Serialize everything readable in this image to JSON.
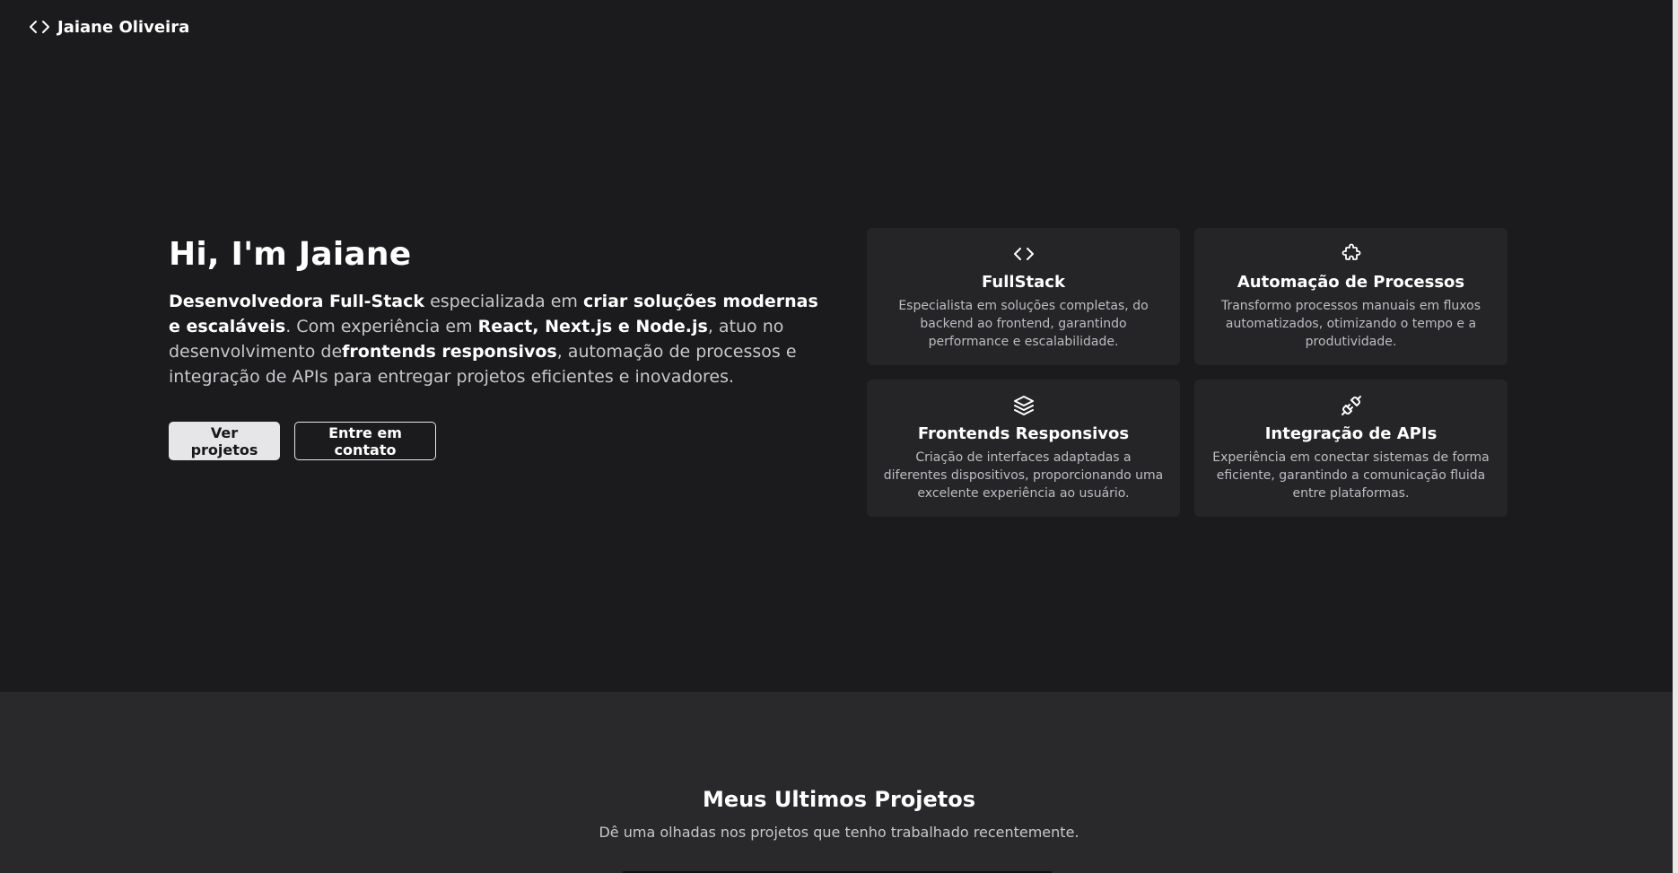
{
  "header": {
    "brand_icon": "code-brackets-icon",
    "brand_name": "Jaiane Oliveira"
  },
  "hero": {
    "title": "Hi, I'm Jaiane",
    "description": {
      "p1_strong": "Desenvolvedora Full-Stack",
      "p2": " especializada em ",
      "p3_strong": "criar soluções modernas e escaláveis",
      "p4": ". Com experiência em ",
      "p5_strong": "React, Next.js e Node.js",
      "p6": ", atuo no desenvolvimento de",
      "p7_strong": "frontends responsivos",
      "p8": ", automação de processos e integração de APIs para entregar projetos eficientes e inovadores."
    },
    "buttons": {
      "primary": "Ver projetos",
      "secondary": "Entre em contato"
    }
  },
  "cards": [
    {
      "icon": "code-icon",
      "title": "FullStack",
      "text": "Especialista em soluções completas, do backend ao frontend, garantindo performance e escalabilidade."
    },
    {
      "icon": "puzzle-icon",
      "title": "Automação de Processos",
      "text": "Transformo processos manuais em fluxos automatizados, otimizando o tempo e a produtividade."
    },
    {
      "icon": "layers-icon",
      "title": "Frontends Responsivos",
      "text": "Criação de interfaces adaptadas a diferentes dispositivos, proporcionando uma excelente experiência ao usuário."
    },
    {
      "icon": "plug-icon",
      "title": "Integração de APIs",
      "text": "Experiência em conectar sistemas de forma eficiente, garantindo a comunicação fluida entre plataformas."
    }
  ],
  "projects": {
    "title": "Meus Ultimos Projetos",
    "subtitle": "Dê uma olhadas nos projetos que tenho trabalhado recentemente."
  },
  "colors": {
    "background": "#1b1b1d",
    "card": "#252527",
    "section_alt": "#29292b",
    "primary_button": "#e6e6e8"
  }
}
